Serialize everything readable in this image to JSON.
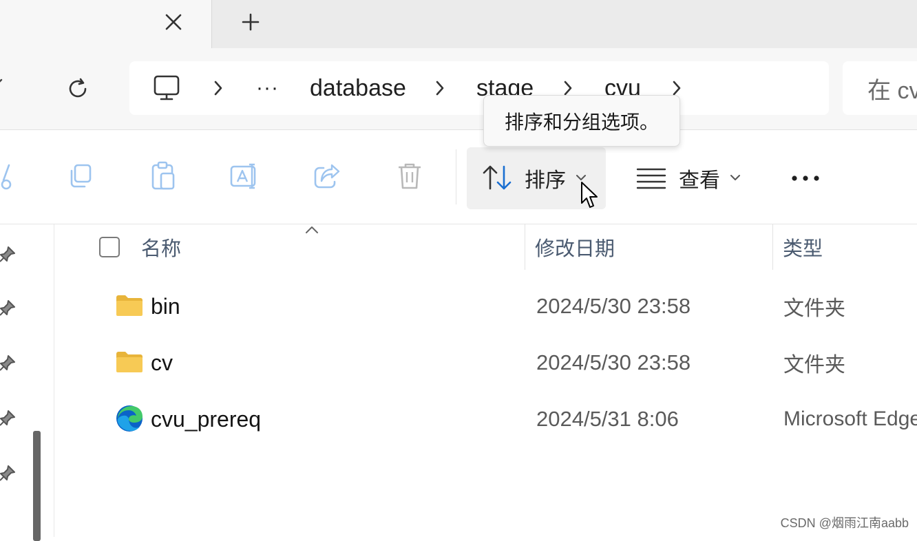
{
  "tabbar": {
    "close_icon": "close-icon",
    "new_tab_icon": "plus-icon"
  },
  "addressbar": {
    "breadcrumb": {
      "root_icon": "this-pc-icon",
      "overflow": "···",
      "segments": [
        "database",
        "stage",
        "cvu"
      ]
    },
    "search_placeholder": "在 cvu"
  },
  "toolbar": {
    "cut_icon": "cut-icon",
    "copy_icon": "copy-icon",
    "paste_icon": "paste-icon",
    "rename_icon": "rename-icon",
    "share_icon": "share-icon",
    "delete_icon": "delete-icon",
    "sort_label": "排序",
    "view_label": "查看",
    "more_label": "···"
  },
  "tooltip": {
    "text": "排序和分组选项。"
  },
  "file_list": {
    "columns": {
      "name": "名称",
      "modified": "修改日期",
      "type": "类型"
    },
    "rows": [
      {
        "name": "bin",
        "modified": "2024/5/30 23:58",
        "type": "文件夹",
        "icon": "folder-icon"
      },
      {
        "name": "cv",
        "modified": "2024/5/30 23:58",
        "type": "文件夹",
        "icon": "folder-icon"
      },
      {
        "name": "cvu_prereq",
        "modified": "2024/5/31 8:06",
        "type": "Microsoft Edge",
        "icon": "edge-icon"
      }
    ]
  },
  "colors": {
    "accent_blue": "#1a6fd1",
    "folder_yellow": "#f5c542",
    "header_text": "#4a5a70"
  },
  "watermark": "CSDN @烟雨江南aabb"
}
